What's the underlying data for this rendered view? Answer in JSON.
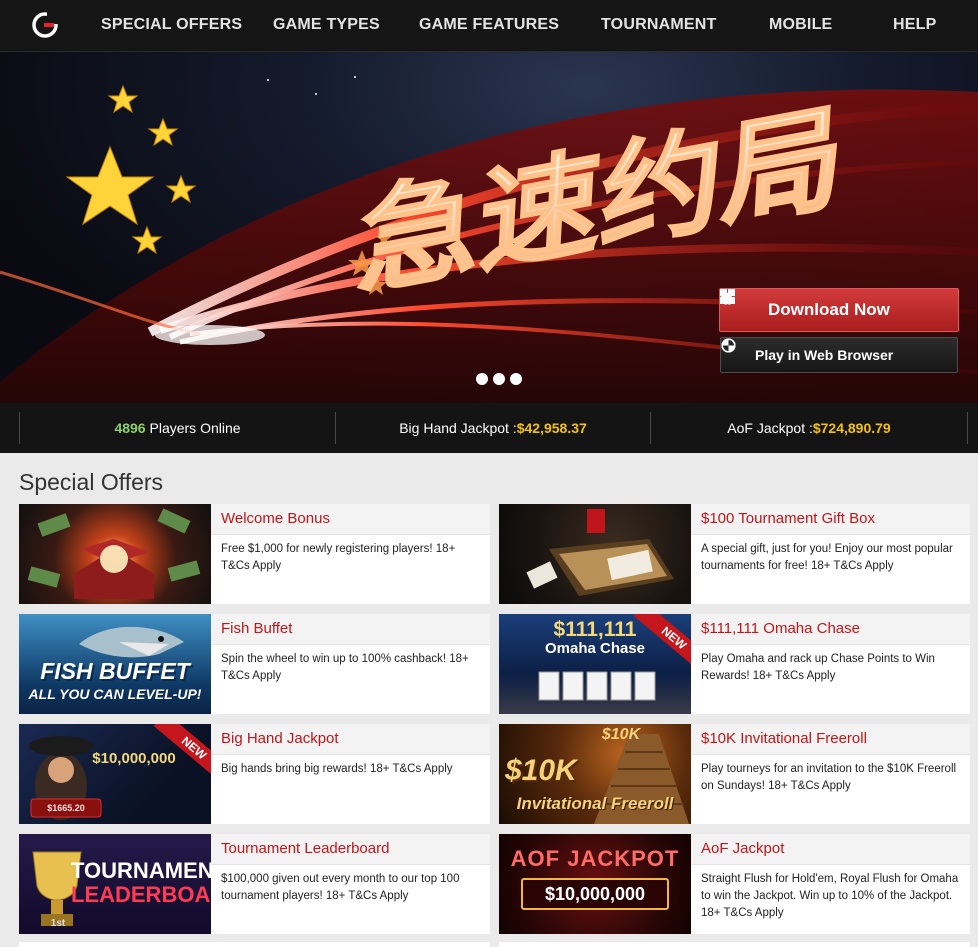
{
  "nav": {
    "items": [
      {
        "label": "SPECIAL OFFERS"
      },
      {
        "label": "GAME TYPES"
      },
      {
        "label": "GAME FEATURES"
      },
      {
        "label": "TOURNAMENT"
      },
      {
        "label": "MOBILE"
      },
      {
        "label": "HELP"
      }
    ]
  },
  "hero": {
    "headline": "急速约局",
    "download_label": "Download Now",
    "web_label": "Play in Web Browser",
    "slide_count": 3
  },
  "stats": {
    "players_count": "4896",
    "players_label": " Players Online",
    "big_hand_label": "Big Hand Jackpot :",
    "big_hand_value": "$42,958.37",
    "aof_label": "AoF Jackpot :",
    "aof_value": "$724,890.79"
  },
  "offers": {
    "heading": "Special Offers",
    "cards": [
      {
        "title": "Welcome Bonus",
        "desc": "Free $1,000 for newly registering players! 18+ T&Cs Apply"
      },
      {
        "title": "$100 Tournament Gift Box",
        "desc": "A special gift, just for you! Enjoy our most popular tournaments for free! 18+ T&Cs Apply"
      },
      {
        "title": "Fish Buffet",
        "desc": "Spin the wheel to win up to 100% cashback! 18+ T&Cs Apply",
        "thumb_line1": "FISH BUFFET",
        "thumb_line2": "ALL YOU CAN LEVEL-UP!"
      },
      {
        "title": "$111,111 Omaha Chase",
        "desc": "Play Omaha and rack up Chase Points to Win Rewards! 18+ T&Cs Apply",
        "thumb_line1": "$111,111",
        "thumb_line2": "Omaha Chase",
        "ribbon": "NEW"
      },
      {
        "title": "Big Hand Jackpot",
        "desc": "Big hands bring big rewards! 18+ T&Cs Apply",
        "thumb_line1": "$10,000,000",
        "thumb_line2": "$1665.20",
        "ribbon": "NEW"
      },
      {
        "title": "$10K Invitational Freeroll",
        "desc": "Play tourneys for an invitation to the $10K Freeroll on Sundays! 18+ T&Cs Apply",
        "thumb_line1": "$10K",
        "thumb_line2": "$10K",
        "thumb_line3": "Invitational Freeroll"
      },
      {
        "title": "Tournament Leaderboard",
        "desc": "$100,000 given out every month to our top 100 tournament players! 18+ T&Cs Apply",
        "thumb_line1": "TOURNAMENT",
        "thumb_line2": "LEADERBOARD",
        "thumb_line3": "1st"
      },
      {
        "title": "AoF Jackpot",
        "desc": "Straight Flush for Hold'em, Royal Flush for Omaha to win the Jackpot. Win up to 10% of the Jackpot. 18+ T&Cs Apply",
        "thumb_line1": "AOF JACKPOT",
        "thumb_line2": "$10,000,000"
      }
    ]
  },
  "colors": {
    "nav_bg": "#151515",
    "accent_red": "#c0161b",
    "players_green": "#8fd06a",
    "jackpot_gold": "#f4c20d"
  }
}
